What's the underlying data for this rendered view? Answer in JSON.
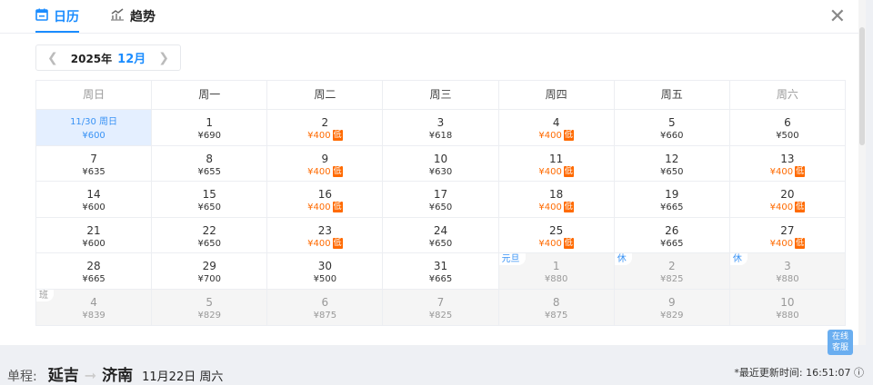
{
  "tabs": [
    {
      "label": "日历",
      "icon": "calendar-icon",
      "active": true
    },
    {
      "label": "趋势",
      "icon": "trend-chart-icon",
      "active": false
    }
  ],
  "nav": {
    "year": "2025年",
    "month": "12月"
  },
  "weekdays": [
    "周日",
    "周一",
    "周二",
    "周三",
    "周四",
    "周五",
    "周六"
  ],
  "low_badge": "低",
  "rows": [
    [
      {
        "n": "11/30 周日",
        "p": "¥600",
        "sel": true
      },
      {
        "n": "1",
        "p": "¥690"
      },
      {
        "n": "2",
        "p": "¥400",
        "low": true
      },
      {
        "n": "3",
        "p": "¥618"
      },
      {
        "n": "4",
        "p": "¥400",
        "low": true
      },
      {
        "n": "5",
        "p": "¥660"
      },
      {
        "n": "6",
        "p": "¥500"
      }
    ],
    [
      {
        "n": "7",
        "p": "¥635"
      },
      {
        "n": "8",
        "p": "¥655"
      },
      {
        "n": "9",
        "p": "¥400",
        "low": true
      },
      {
        "n": "10",
        "p": "¥630"
      },
      {
        "n": "11",
        "p": "¥400",
        "low": true
      },
      {
        "n": "12",
        "p": "¥650"
      },
      {
        "n": "13",
        "p": "¥400",
        "low": true
      }
    ],
    [
      {
        "n": "14",
        "p": "¥600"
      },
      {
        "n": "15",
        "p": "¥650"
      },
      {
        "n": "16",
        "p": "¥400",
        "low": true
      },
      {
        "n": "17",
        "p": "¥650"
      },
      {
        "n": "18",
        "p": "¥400",
        "low": true
      },
      {
        "n": "19",
        "p": "¥665"
      },
      {
        "n": "20",
        "p": "¥400",
        "low": true
      }
    ],
    [
      {
        "n": "21",
        "p": "¥600"
      },
      {
        "n": "22",
        "p": "¥650"
      },
      {
        "n": "23",
        "p": "¥400",
        "low": true
      },
      {
        "n": "24",
        "p": "¥650"
      },
      {
        "n": "25",
        "p": "¥400",
        "low": true
      },
      {
        "n": "26",
        "p": "¥665"
      },
      {
        "n": "27",
        "p": "¥400",
        "low": true
      }
    ],
    [
      {
        "n": "28",
        "p": "¥665"
      },
      {
        "n": "29",
        "p": "¥700"
      },
      {
        "n": "30",
        "p": "¥500"
      },
      {
        "n": "31",
        "p": "¥665"
      },
      {
        "n": "1",
        "p": "¥880",
        "dim": true,
        "tag": "元旦"
      },
      {
        "n": "2",
        "p": "¥825",
        "dim": true,
        "tag": "休"
      },
      {
        "n": "3",
        "p": "¥880",
        "dim": true,
        "tag": "休"
      }
    ],
    [
      {
        "n": "4",
        "p": "¥839",
        "dim": true,
        "tag": "班",
        "tagGray": true
      },
      {
        "n": "5",
        "p": "¥829",
        "dim": true
      },
      {
        "n": "6",
        "p": "¥875",
        "dim": true
      },
      {
        "n": "7",
        "p": "¥825",
        "dim": true
      },
      {
        "n": "8",
        "p": "¥875",
        "dim": true
      },
      {
        "n": "9",
        "p": "¥829",
        "dim": true
      },
      {
        "n": "10",
        "p": "¥880",
        "dim": true
      }
    ]
  ],
  "service": {
    "line1": "在线",
    "line2": "客服"
  },
  "footer": {
    "type": "单程:",
    "from": "延吉",
    "to": "济南",
    "date": "11月22日 周六",
    "updated": "*最近更新时间: 16:51:07"
  },
  "colors": {
    "accent": "#1a8cff",
    "low": "#ff6a00"
  }
}
